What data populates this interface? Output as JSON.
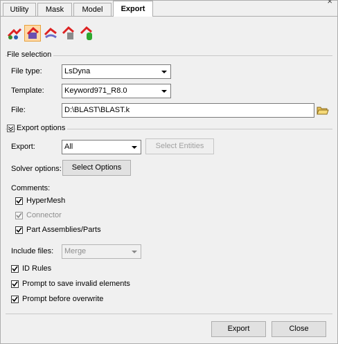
{
  "tabs": [
    {
      "label": "Utility"
    },
    {
      "label": "Mask"
    },
    {
      "label": "Model"
    },
    {
      "label": "Export"
    }
  ],
  "window": {
    "close_glyph": "×"
  },
  "toolbar": {
    "icons": [
      "export-solver-deck-icon",
      "export-geometry-icon",
      "export-fe-surface-icon",
      "export-tables-icon",
      "export-connectors-icon"
    ]
  },
  "file_selection": {
    "group_label": "File selection",
    "file_type_label": "File type:",
    "file_type_value": "LsDyna",
    "template_label": "Template:",
    "template_value": "Keyword971_R8.0",
    "file_label": "File:",
    "file_value": "D:\\BLAST\\BLAST.k"
  },
  "export_options": {
    "group_label": "Export options",
    "export_label": "Export:",
    "export_value": "All",
    "select_entities_label": "Select Entities",
    "solver_options_label": "Solver options:",
    "select_options_label": "Select Options",
    "comments_label": "Comments:",
    "comments": [
      {
        "label": "HyperMesh",
        "checked": true,
        "enabled": true
      },
      {
        "label": "Connector",
        "checked": true,
        "enabled": false
      },
      {
        "label": "Part Assemblies/Parts",
        "checked": true,
        "enabled": true
      }
    ],
    "include_files_label": "Include files:",
    "include_files_value": "Merge",
    "options": [
      {
        "label": "ID Rules",
        "checked": true
      },
      {
        "label": "Prompt to save invalid elements",
        "checked": true
      },
      {
        "label": "Prompt before overwrite",
        "checked": true
      }
    ]
  },
  "actions": {
    "export_label": "Export",
    "close_label": "Close"
  }
}
